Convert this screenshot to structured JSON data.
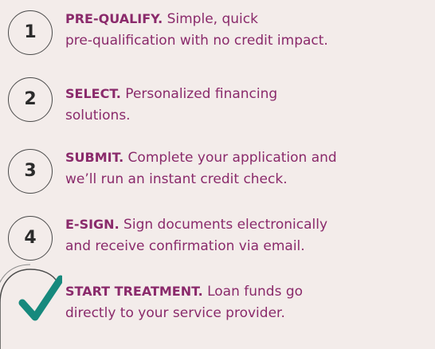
{
  "steps": [
    {
      "number": "1",
      "heading": "PRE-QUALIFY.",
      "line1": " Simple, quick",
      "line2": "pre-qualification with no credit impact."
    },
    {
      "number": "2",
      "heading": "SELECT.",
      "line1": " Personalized financing",
      "line2": "solutions."
    },
    {
      "number": "3",
      "heading": "SUBMIT.",
      "line1": " Complete your application and",
      "line2": "we’ll run an instant credit check."
    },
    {
      "number": "4",
      "heading": "E-SIGN.",
      "line1": " Sign documents electronically",
      "line2": "and receive confirmation via email."
    },
    {
      "heading": "START TREATMENT.",
      "line1": " Loan funds go",
      "line2": "directly to your service provider."
    }
  ],
  "colors": {
    "background": "#f3ecea",
    "text_purple": "#8a2a6b",
    "check_teal": "#16897d",
    "circle_border": "#4b4b4b"
  },
  "icons": {
    "final_step": "checkmark-icon"
  }
}
